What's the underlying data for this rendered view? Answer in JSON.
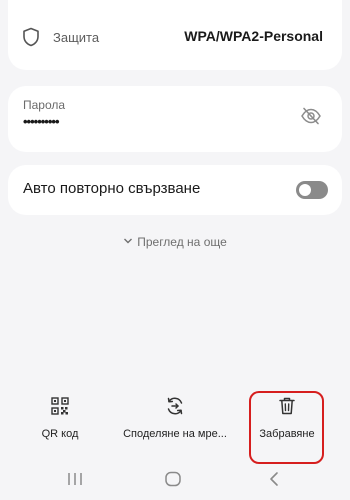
{
  "security": {
    "label": "Защита",
    "value": "WPA/WPA2-Personal",
    "icon": "shield-icon"
  },
  "password": {
    "label": "Парола",
    "value": "••••••••••",
    "icon": "eye-slash-icon"
  },
  "reconnect": {
    "label": "Авто повторно свързване",
    "enabled": false
  },
  "view_more": {
    "label": "Преглед на още"
  },
  "actions": [
    {
      "label": "QR код",
      "icon": "qr-code-icon"
    },
    {
      "label": "Споделяне на мре...",
      "icon": "share-network-icon"
    },
    {
      "label": "Забравяне",
      "icon": "trash-icon"
    }
  ],
  "highlight_color": "#d61e1e",
  "navbar": {
    "buttons": [
      "recents",
      "home",
      "back"
    ]
  }
}
